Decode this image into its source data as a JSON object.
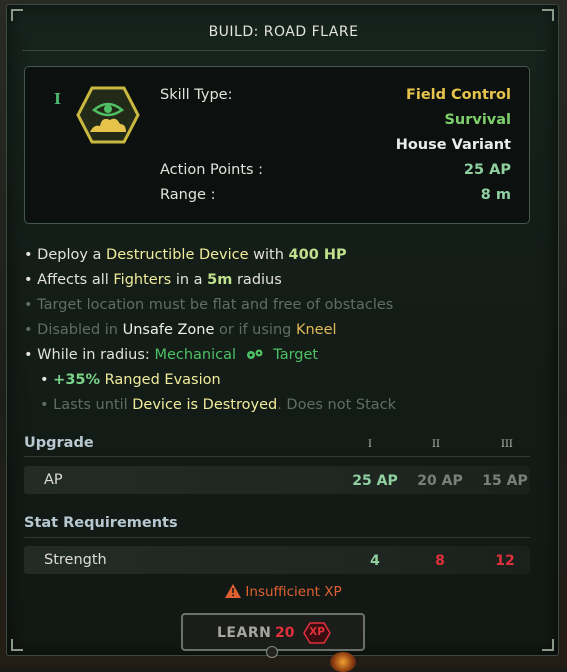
{
  "title": "BUILD: ROAD FLARE",
  "tier": "I",
  "skill": {
    "skill_type_label": "Skill Type:",
    "types": [
      "Field Control",
      "Survival",
      "House Variant"
    ],
    "action_points_label": "Action Points :",
    "action_points_value": "25 AP",
    "range_label": "Range :",
    "range_value": "8 m"
  },
  "bullets": {
    "b1": {
      "pre": "• Deploy a",
      "k1": "Destructible Device",
      "mid": "with",
      "k2": "400 HP"
    },
    "b2": {
      "pre": "• Affects all",
      "k1": "Fighters",
      "mid": "in a",
      "k2": "5m",
      "post": "radius"
    },
    "b3": {
      "text": "• Target location must be flat and free of obstacles"
    },
    "b4": {
      "pre": "• Disabled in",
      "k1": "Unsafe Zone",
      "mid": "or if using",
      "k2": "Kneel"
    },
    "b5": {
      "pre": "• While in radius:",
      "k1": "Mechanical",
      "k2": "Target"
    },
    "b6": {
      "pre": "•",
      "k1": "+35%",
      "k2": "Ranged Evasion"
    },
    "b7": {
      "pre": "• Lasts until",
      "k1": "Device is Destroyed",
      "post": ". Does not Stack"
    }
  },
  "upgrade": {
    "heading": "Upgrade",
    "tiers": [
      "I",
      "II",
      "III"
    ],
    "row_label": "AP",
    "values": [
      "25 AP",
      "20 AP",
      "15 AP"
    ]
  },
  "stats": {
    "heading": "Stat Requirements",
    "row_label": "Strength",
    "values": [
      "4",
      "8",
      "12"
    ]
  },
  "warning": "Insufficient XP",
  "learn": {
    "label": "LEARN",
    "cost": "20",
    "badge": "XP"
  },
  "colors": {
    "accent": "#e6c44c",
    "good": "#8fd0a0",
    "bad": "#e0303a",
    "warning": "#e06030"
  }
}
